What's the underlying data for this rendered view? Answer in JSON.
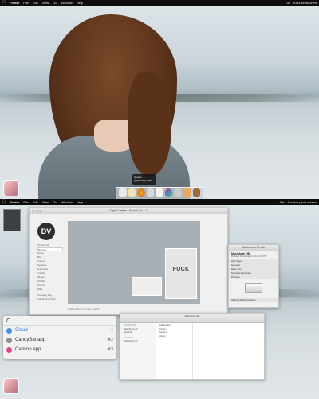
{
  "top_panel": {
    "menubar": {
      "items": [
        "Finder",
        "File",
        "Edit",
        "View",
        "Go",
        "Window",
        "Help"
      ],
      "right_items": [
        "Tue",
        "Kurz se machen"
      ]
    },
    "dock": {
      "tooltip_title": "Quotes",
      "tooltip_sub": "Quote Daly Nero"
    },
    "app_tile_icon": "candybar-icon"
  },
  "bottom_panel": {
    "menubar": {
      "items": [
        "Finder",
        "File",
        "Edit",
        "View",
        "Go",
        "Window",
        "Help"
      ],
      "right_items": [
        "Sat",
        "Surface pinot mariss"
      ]
    },
    "browser_window": {
      "title": "Digital Veritas / Search Ike 1.0",
      "logo": "DV",
      "sidebar_header": "Choose All",
      "sidebar_select": "Browse",
      "sidebar_links": [
        "Home",
        "Bio",
        "Kulture",
        "Systems",
        "Subscribe",
        "Tumblr",
        "Mixtape",
        "Shuffle",
        "Archive",
        "RSS"
      ],
      "sidebar_footer": [
        "Tweeting Day",
        "Tumblr stuff Now"
      ],
      "canvas_title": "FUCK",
      "caption": "Digital is Noir is a Noir Tumblr"
    },
    "info_window": {
      "title": "Macintosh HD Info",
      "name": "Macintosh HD",
      "modified": "Modified: December 03, 2012 6:08 PM",
      "sections": [
        "Add Tags...",
        "General",
        "More Info",
        "Name & Extension",
        "Preview",
        "Sharing & Permissions"
      ]
    },
    "spotlight": {
      "query": "C",
      "results": [
        {
          "label": "Cloud",
          "shortcut": "↩",
          "icon": "cloud-icon",
          "color": "#4a90e2"
        },
        {
          "label": "CandyBar.app",
          "shortcut": "⌘2",
          "icon": "candybar-icon",
          "color": "#8c8c8c"
        },
        {
          "label": "Camino.app",
          "shortcut": "⌘3",
          "icon": "camino-icon",
          "color": "#d84a8e"
        }
      ]
    },
    "finder": {
      "title": "Macintosh HD",
      "sidebar_header": "FAVORITES",
      "sidebar_items": [
        "Macintosh HD",
        "Network"
      ],
      "devices_header": "DEVICES",
      "devices": [
        "Macintosh HD"
      ],
      "folders": [
        "Applications",
        "Library",
        "System",
        "Users"
      ]
    }
  }
}
